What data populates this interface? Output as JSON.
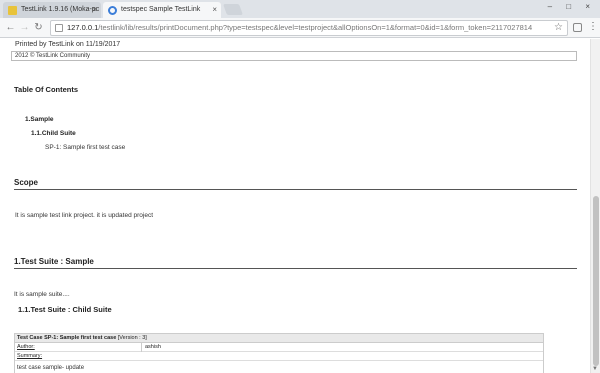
{
  "browser": {
    "tabs": [
      {
        "title": "TestLink 1.9.16 (Moka-pc"
      },
      {
        "title": "testspec Sample TestLink"
      }
    ],
    "tab_close_glyph": "×",
    "window_controls": "–  □  ×",
    "url_host": "127.0.0.1",
    "url_path": "/testlink/lib/results/printDocument.php?type=testspec&level=testproject&allOptionsOn=1&format=0&id=1&form_token=2117027814"
  },
  "page": {
    "printed_by": "Printed by TestLink on 11/19/2017",
    "copyright": "2012 © TestLink Community",
    "toc": {
      "title": "Table Of Contents",
      "items": [
        "1.Sample",
        "1.1.Child Suite",
        "SP-1: Sample first test case"
      ]
    },
    "scope": {
      "heading": "Scope",
      "text": "It is sample test link project. it is updated project"
    },
    "suite": {
      "heading": "1.Test Suite : Sample",
      "description": "It is sample suite....",
      "child_heading": "1.1.Test Suite : Child Suite"
    },
    "testcase": {
      "title": "Test Case SP-1: Sample first test case",
      "version": "[Version : 3]",
      "author_label": "Author:",
      "author_value": "ashish",
      "summary_label": "Summary:",
      "summary_text": "test case sample- update"
    }
  },
  "colors": {
    "tabbar": "#dfe3e8",
    "active_tab": "#f6f7f8",
    "scroll_thumb": "#c1c1c1"
  }
}
